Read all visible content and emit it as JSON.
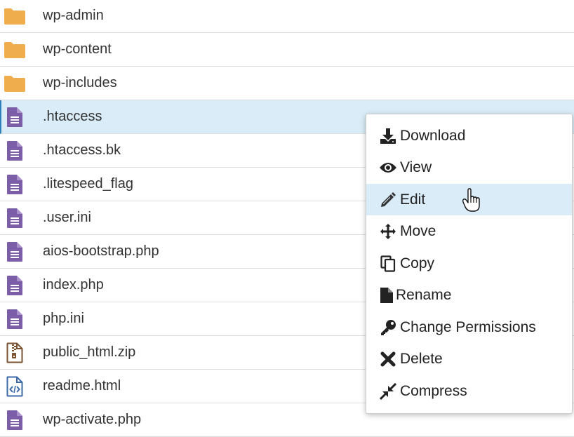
{
  "files": [
    {
      "name": "wp-admin",
      "type": "folder",
      "icon": "folder-icon"
    },
    {
      "name": "wp-content",
      "type": "folder",
      "icon": "folder-icon"
    },
    {
      "name": "wp-includes",
      "type": "folder",
      "icon": "folder-icon"
    },
    {
      "name": ".htaccess",
      "type": "file",
      "icon": "file-text-icon",
      "selected": true
    },
    {
      "name": ".htaccess.bk",
      "type": "file",
      "icon": "file-text-icon"
    },
    {
      "name": ".litespeed_flag",
      "type": "file",
      "icon": "file-text-icon"
    },
    {
      "name": ".user.ini",
      "type": "file",
      "icon": "file-text-icon"
    },
    {
      "name": "aios-bootstrap.php",
      "type": "file",
      "icon": "file-text-icon"
    },
    {
      "name": "index.php",
      "type": "file",
      "icon": "file-text-icon"
    },
    {
      "name": "php.ini",
      "type": "file",
      "icon": "file-text-icon"
    },
    {
      "name": "public_html.zip",
      "type": "archive",
      "icon": "file-zip-icon"
    },
    {
      "name": "readme.html",
      "type": "code",
      "icon": "file-code-icon"
    },
    {
      "name": "wp-activate.php",
      "type": "file",
      "icon": "file-text-icon"
    }
  ],
  "context_menu": [
    {
      "label": "Download",
      "icon": "download-icon"
    },
    {
      "label": "View",
      "icon": "eye-icon"
    },
    {
      "label": "Edit",
      "icon": "pencil-icon",
      "hover": true
    },
    {
      "label": "Move",
      "icon": "move-arrows-icon"
    },
    {
      "label": "Copy",
      "icon": "copy-icon"
    },
    {
      "label": "Rename",
      "icon": "file-icon"
    },
    {
      "label": "Change Permissions",
      "icon": "key-icon"
    },
    {
      "label": "Delete",
      "icon": "x-icon"
    },
    {
      "label": "Compress",
      "icon": "compress-icon"
    }
  ],
  "colors": {
    "folder": "#f0ad4e",
    "file": "#7b5ea7",
    "selected_bg": "#d9ecf7",
    "hover_bg": "#d9ecf7"
  }
}
